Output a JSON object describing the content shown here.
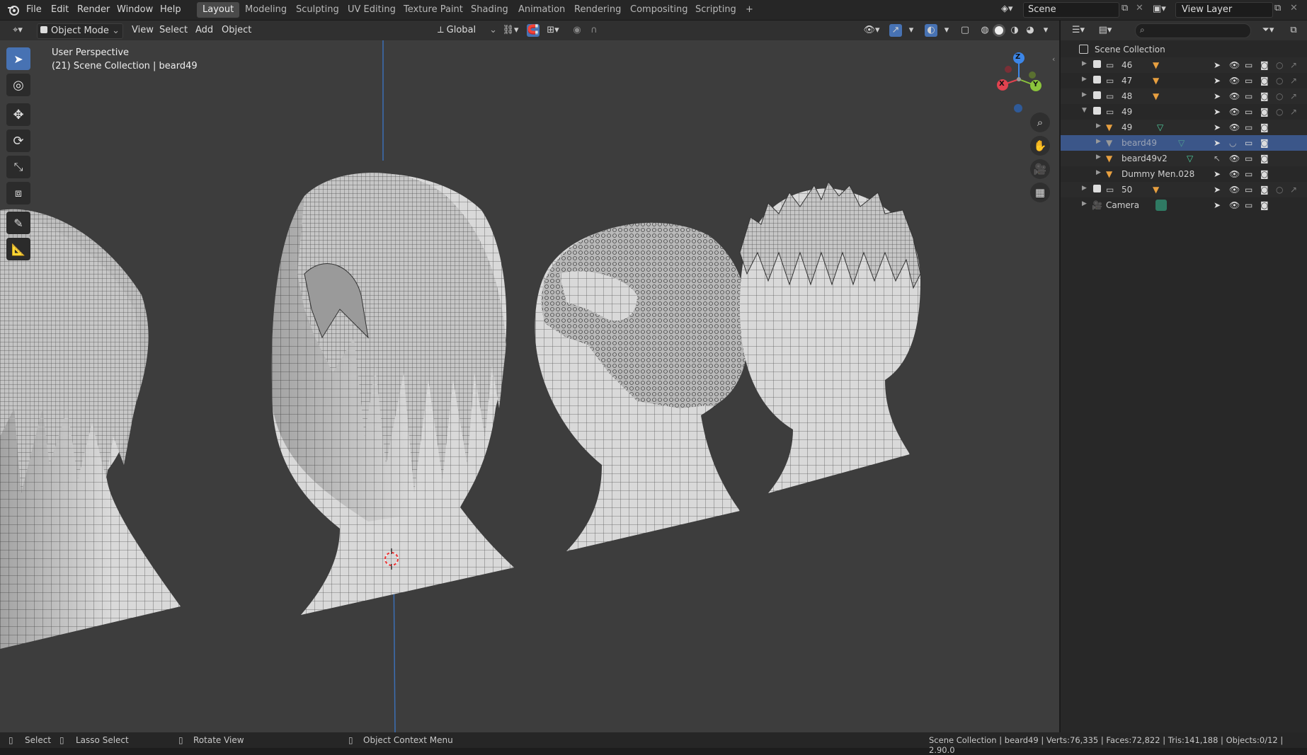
{
  "topbar": {
    "menus": [
      "File",
      "Edit",
      "Render",
      "Window",
      "Help"
    ],
    "workspaces": [
      "Layout",
      "Modeling",
      "Sculpting",
      "UV Editing",
      "Texture Paint",
      "Shading",
      "Animation",
      "Rendering",
      "Compositing",
      "Scripting"
    ],
    "active_workspace": "Layout",
    "add_tab_label": "+",
    "scene_label": "Scene",
    "view_layer_label": "View Layer"
  },
  "viewport_header": {
    "mode": "Object Mode",
    "menus": [
      "View",
      "Select",
      "Add",
      "Object"
    ],
    "transform_orientation": "Global"
  },
  "viewport": {
    "overlay_title": "User Perspective",
    "overlay_subtitle": "(21) Scene Collection | beard49",
    "gizmo_axes": {
      "z": "Z",
      "x": "X",
      "y": "Y"
    }
  },
  "outliner": {
    "root": "Scene Collection",
    "rows": [
      {
        "label": "46",
        "type": "collection"
      },
      {
        "label": "47",
        "type": "collection"
      },
      {
        "label": "48",
        "type": "collection"
      },
      {
        "label": "49",
        "type": "collection"
      },
      {
        "label": "49",
        "type": "mesh"
      },
      {
        "label": "beard49",
        "type": "mesh",
        "selected": true
      },
      {
        "label": "beard49v2",
        "type": "mesh"
      },
      {
        "label": "Dummy Men.028",
        "type": "mesh"
      },
      {
        "label": "50",
        "type": "collection"
      },
      {
        "label": "Camera",
        "type": "camera"
      }
    ]
  },
  "statusbar": {
    "select": "Select",
    "lasso": "Lasso Select",
    "rotate": "Rotate View",
    "context": "Object Context Menu",
    "stats": "Scene Collection | beard49 | Verts:76,335 | Faces:72,822 | Tris:141,188 | Objects:0/12 | 2.90.0"
  },
  "colors": {
    "accent": "#4772b3",
    "selected_row": "#3b5689",
    "mesh_icon": "#e8a040",
    "mesh_data_icon": "#4fd0a0",
    "axis_x": "#e0424f",
    "axis_y": "#8bc43c",
    "axis_z": "#3c86e8"
  }
}
